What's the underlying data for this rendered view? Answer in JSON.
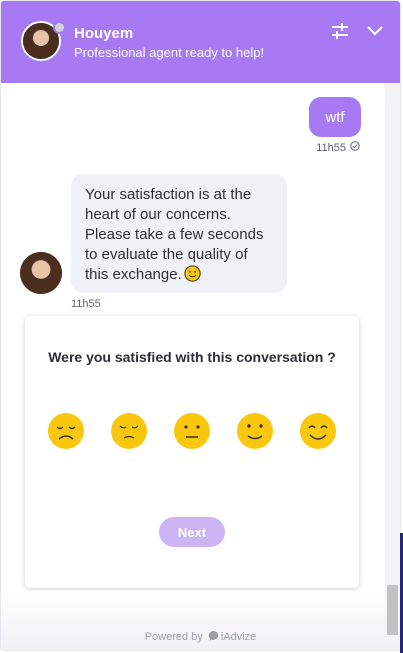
{
  "header": {
    "agent_name": "Houyem",
    "agent_status": "Professional agent ready to help!",
    "settings_icon": "sliders-icon",
    "collapse_icon": "chevron-down-icon"
  },
  "messages": {
    "user_text": "wtf",
    "user_time": "11h55",
    "agent_lines": [
      "Your satisfaction is at the heart of our concerns.",
      "Please take a few seconds to evaluate the quality of this exchange."
    ],
    "agent_time": "11h55"
  },
  "survey": {
    "question": "Were you satisfied with this conversation ?",
    "ratings": [
      "very-sad-face-icon",
      "sad-face-icon",
      "neutral-face-icon",
      "slight-smile-icon",
      "happy-face-icon"
    ],
    "next_label": "Next"
  },
  "footer": {
    "powered_by": "Powered by",
    "brand": "iAdvize"
  },
  "colors": {
    "accent": "#a779f2",
    "next_disabled": "#cdb5f5",
    "bubble_bg": "#f0f1f4"
  }
}
